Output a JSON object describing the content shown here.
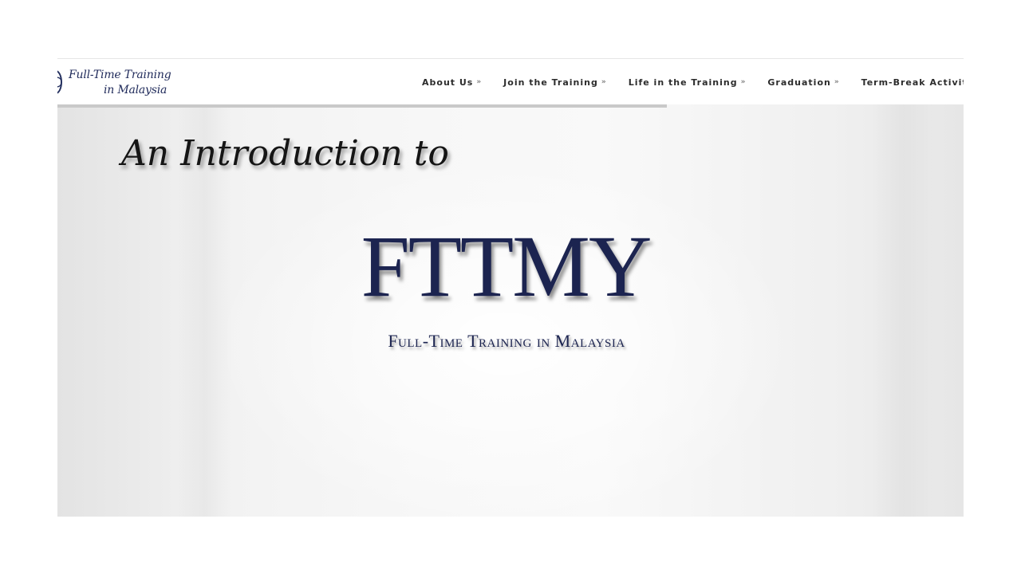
{
  "logo": {
    "line1": "Full-Time Training",
    "line2": "in Malaysia"
  },
  "nav": {
    "items": [
      {
        "label": "About Us",
        "chevron": "»"
      },
      {
        "label": "Join the Training",
        "chevron": "»"
      },
      {
        "label": "Life in the Training",
        "chevron": "»"
      },
      {
        "label": "Graduation",
        "chevron": "»"
      },
      {
        "label": "Term-Break Activiti",
        "chevron": ""
      }
    ]
  },
  "hero": {
    "intro": "An Introduction to",
    "title": "FTTMY",
    "subtitle": "Full-Time Training in Malaysia"
  },
  "colors": {
    "brand_navy": "#1c2450",
    "nav_text": "#2c2c2c",
    "progress_bar": "#c9c9c9"
  }
}
